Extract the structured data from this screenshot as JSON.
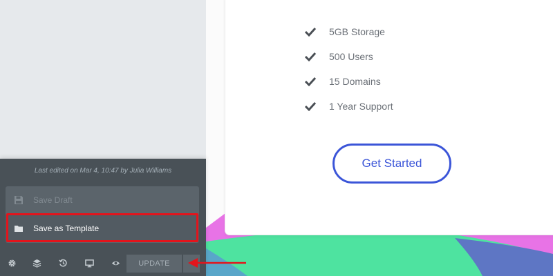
{
  "editor": {
    "last_edited": "Last edited on Mar 4, 10:47 by Julia Williams",
    "menu": {
      "save_draft": "Save Draft",
      "save_template": "Save as Template"
    },
    "footer": {
      "update_label": "UPDATE",
      "icons": [
        "gear-icon",
        "layers-icon",
        "history-icon",
        "desktop-icon",
        "eye-icon"
      ]
    }
  },
  "pricing": {
    "features": [
      "5GB Storage",
      "500 Users",
      "15 Domains",
      "1 Year Support"
    ],
    "cta_label": "Get Started"
  },
  "colors": {
    "accent_blue": "#3b55d8",
    "highlight_red": "#e3141c",
    "panel_dark": "#495157",
    "wave_green": "#4ee3a0",
    "wave_pink": "#e873e6",
    "wave_indigo": "#5e76c4"
  }
}
